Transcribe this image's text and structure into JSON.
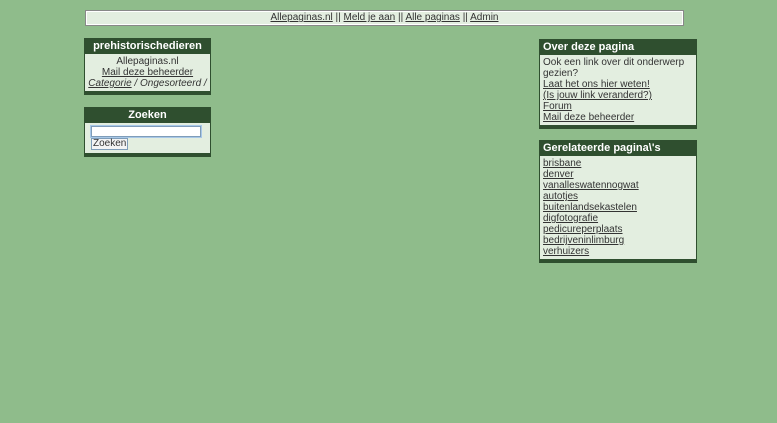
{
  "topnav": {
    "links": [
      "Allepaginas.nl",
      "Meld je aan",
      "Alle paginas",
      "Admin"
    ],
    "separator": "||"
  },
  "info_box": {
    "title": "prehistorischedieren",
    "site": "Allepaginas.nl",
    "mail": "Mail deze beheerder",
    "category_link": "Categorie",
    "category_sep": " / ",
    "category_value": "Ongesorteerd",
    "category_trail": " /"
  },
  "search_box": {
    "title": "Zoeken",
    "input_value": "",
    "button_label": "Zoeken"
  },
  "about_box": {
    "title": "Over deze pagina",
    "intro": "Ook een link over dit onderwerp gezien?",
    "links": [
      "Laat het ons hier weten!",
      "(Is jouw link veranderd?)",
      "Forum",
      "Mail deze beheerder"
    ]
  },
  "related_box": {
    "title": "Gerelateerde pagina\\'s",
    "links": [
      "brisbane",
      "denver",
      "vanalleswatennogwat",
      "autotjes",
      "buitenlandsekastelen",
      "digfotografie",
      "pedicureperplaats",
      "bedrijveninlimburg",
      "verhuizers"
    ]
  }
}
